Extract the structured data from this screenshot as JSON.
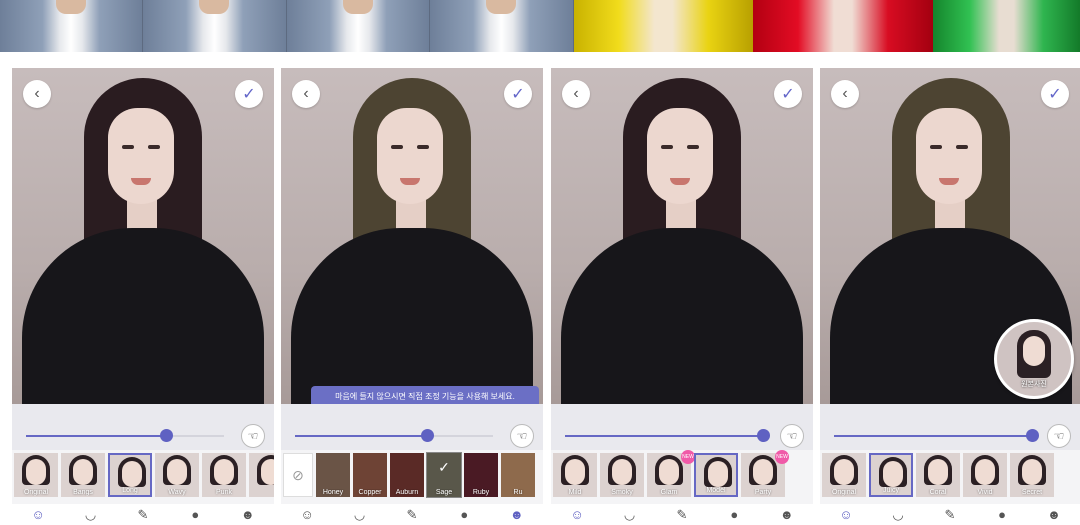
{
  "colors": {
    "accent": "#6668c4",
    "tooltip_bg": "#6b6fc5",
    "new_badge": "#f05aa8"
  },
  "icons": {
    "back": "‹",
    "confirm": "✓",
    "hand": "☜",
    "none": "⊘"
  },
  "panels": [
    {
      "id": "p1",
      "hair_color": "#2a1c20",
      "slider_percent": 70,
      "presets": [
        {
          "label": "Original",
          "selected": false
        },
        {
          "label": "Bangs",
          "selected": false
        },
        {
          "label": "Long",
          "selected": true
        },
        {
          "label": "Wavy",
          "selected": false
        },
        {
          "label": "Punk",
          "selected": false
        },
        {
          "label": "",
          "selected": false
        }
      ]
    },
    {
      "id": "p2",
      "hair_color": "#4d4432",
      "slider_percent": 66,
      "tooltip": "마음에 들지 않으시면 직접 조정 기능을 사용해 보세요.",
      "swatches": [
        {
          "label": "Honey",
          "color": "#6a5446"
        },
        {
          "label": "Copper",
          "color": "#6e4335"
        },
        {
          "label": "Auburn",
          "color": "#5a2a26"
        },
        {
          "label": "Sage",
          "color": "#59574a",
          "checked": true
        },
        {
          "label": "Ruby",
          "color": "#4a1a24"
        },
        {
          "label": "Ru",
          "color": "#8e6a4c"
        }
      ]
    },
    {
      "id": "p3",
      "hair_color": "#2a1c20",
      "slider_percent": 100,
      "presets": [
        {
          "label": "Mild",
          "selected": false
        },
        {
          "label": "Smoky",
          "selected": false
        },
        {
          "label": "Glam",
          "selected": false,
          "badge": "NEW"
        },
        {
          "label": "Model",
          "selected": true
        },
        {
          "label": "Party",
          "selected": false,
          "badge": "NEW"
        },
        {
          "label": "",
          "selected": false
        }
      ]
    },
    {
      "id": "p4",
      "hair_color": "#4d4432",
      "slider_percent": 100,
      "before_label": "원본사진",
      "presets": [
        {
          "label": "Original",
          "selected": false
        },
        {
          "label": "Juicy",
          "selected": true
        },
        {
          "label": "Coral",
          "selected": false
        },
        {
          "label": "Vivid",
          "selected": false
        },
        {
          "label": "Secret",
          "selected": false
        },
        {
          "label": "",
          "selected": false
        }
      ]
    }
  ],
  "tools": [
    "face-tool",
    "cup-tool",
    "lipstick-tool",
    "head-tool",
    "hair-tool",
    "more-tool"
  ]
}
